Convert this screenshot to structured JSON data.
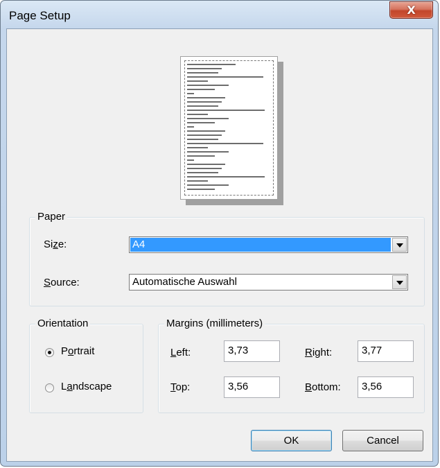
{
  "window": {
    "title": "Page Setup",
    "close_symbol": "X"
  },
  "paper": {
    "group_label": "Paper",
    "size_label_pre": "Si",
    "size_label_u": "z",
    "size_label_post": "e:",
    "size_value": "A4",
    "source_label_u": "S",
    "source_label_post": "ource:",
    "source_value": "Automatische Auswahl"
  },
  "orientation": {
    "group_label": "Orientation",
    "portrait_pre": "P",
    "portrait_u": "o",
    "portrait_post": "rtrait",
    "landscape_pre": "L",
    "landscape_u": "a",
    "landscape_post": "ndscape",
    "selected": "Portrait"
  },
  "margins": {
    "group_label": "Margins (millimeters)",
    "left_label_u": "L",
    "left_label_post": "eft:",
    "left_value": "3,73",
    "right_label_u": "R",
    "right_label_post": "ight:",
    "right_value": "3,77",
    "top_label_u": "T",
    "top_label_post": "op:",
    "top_value": "3,56",
    "bottom_label_u": "B",
    "bottom_label_post": "ottom:",
    "bottom_value": "3,56"
  },
  "buttons": {
    "ok": "OK",
    "cancel": "Cancel"
  }
}
